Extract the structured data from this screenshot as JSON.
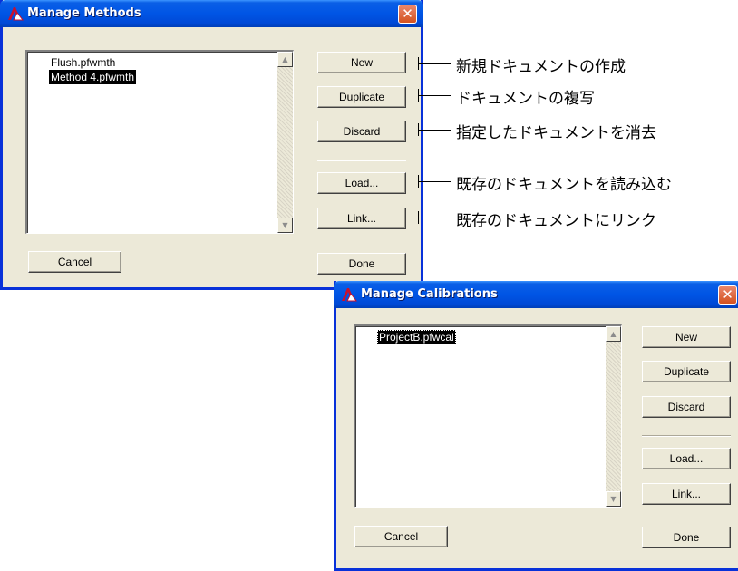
{
  "methods_dialog": {
    "title": "Manage Methods",
    "close_glyph": "✕",
    "list_items": [
      "Flush.pfwmth",
      "Method 4.pfwmth"
    ],
    "selected_index": 1,
    "buttons": {
      "new": "New",
      "duplicate": "Duplicate",
      "discard": "Discard",
      "load": "Load...",
      "link": "Link...",
      "cancel": "Cancel",
      "done": "Done"
    }
  },
  "calibrations_dialog": {
    "title": "Manage Calibrations",
    "close_glyph": "✕",
    "list_items": [
      "ProjectB.pfwcal"
    ],
    "selected_index": 0,
    "buttons": {
      "new": "New",
      "duplicate": "Duplicate",
      "discard": "Discard",
      "load": "Load...",
      "link": "Link...",
      "cancel": "Cancel",
      "done": "Done"
    }
  },
  "annotations": {
    "new": "新規ドキュメントの作成",
    "duplicate": "ドキュメントの複写",
    "discard": "指定したドキュメントを消去",
    "load": "既存のドキュメントを読み込む",
    "link": "既存のドキュメントにリンク"
  },
  "scroll_icons": {
    "up": "▲",
    "down": "▼"
  },
  "colors": {
    "titlebar": "#0055e5",
    "dialog_bg": "#ece9d8",
    "close_button": "#d4521f",
    "selection": "#000000"
  }
}
